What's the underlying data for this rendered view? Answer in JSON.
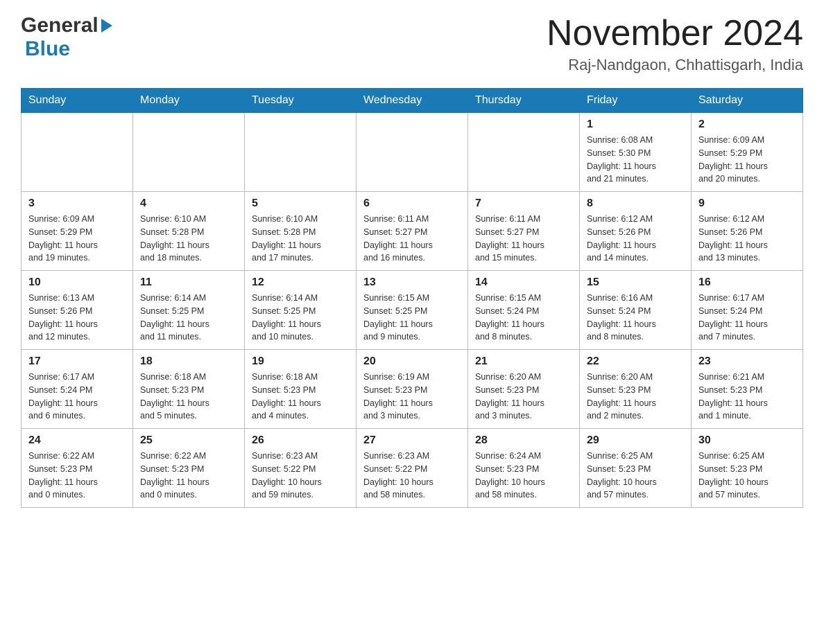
{
  "header": {
    "logo_general": "General",
    "logo_blue": "Blue",
    "title": "November 2024",
    "subtitle": "Raj-Nandgaon, Chhattisgarh, India"
  },
  "days_of_week": [
    "Sunday",
    "Monday",
    "Tuesday",
    "Wednesday",
    "Thursday",
    "Friday",
    "Saturday"
  ],
  "weeks": [
    [
      {
        "day": "",
        "info": ""
      },
      {
        "day": "",
        "info": ""
      },
      {
        "day": "",
        "info": ""
      },
      {
        "day": "",
        "info": ""
      },
      {
        "day": "",
        "info": ""
      },
      {
        "day": "1",
        "info": "Sunrise: 6:08 AM\nSunset: 5:30 PM\nDaylight: 11 hours\nand 21 minutes."
      },
      {
        "day": "2",
        "info": "Sunrise: 6:09 AM\nSunset: 5:29 PM\nDaylight: 11 hours\nand 20 minutes."
      }
    ],
    [
      {
        "day": "3",
        "info": "Sunrise: 6:09 AM\nSunset: 5:29 PM\nDaylight: 11 hours\nand 19 minutes."
      },
      {
        "day": "4",
        "info": "Sunrise: 6:10 AM\nSunset: 5:28 PM\nDaylight: 11 hours\nand 18 minutes."
      },
      {
        "day": "5",
        "info": "Sunrise: 6:10 AM\nSunset: 5:28 PM\nDaylight: 11 hours\nand 17 minutes."
      },
      {
        "day": "6",
        "info": "Sunrise: 6:11 AM\nSunset: 5:27 PM\nDaylight: 11 hours\nand 16 minutes."
      },
      {
        "day": "7",
        "info": "Sunrise: 6:11 AM\nSunset: 5:27 PM\nDaylight: 11 hours\nand 15 minutes."
      },
      {
        "day": "8",
        "info": "Sunrise: 6:12 AM\nSunset: 5:26 PM\nDaylight: 11 hours\nand 14 minutes."
      },
      {
        "day": "9",
        "info": "Sunrise: 6:12 AM\nSunset: 5:26 PM\nDaylight: 11 hours\nand 13 minutes."
      }
    ],
    [
      {
        "day": "10",
        "info": "Sunrise: 6:13 AM\nSunset: 5:26 PM\nDaylight: 11 hours\nand 12 minutes."
      },
      {
        "day": "11",
        "info": "Sunrise: 6:14 AM\nSunset: 5:25 PM\nDaylight: 11 hours\nand 11 minutes."
      },
      {
        "day": "12",
        "info": "Sunrise: 6:14 AM\nSunset: 5:25 PM\nDaylight: 11 hours\nand 10 minutes."
      },
      {
        "day": "13",
        "info": "Sunrise: 6:15 AM\nSunset: 5:25 PM\nDaylight: 11 hours\nand 9 minutes."
      },
      {
        "day": "14",
        "info": "Sunrise: 6:15 AM\nSunset: 5:24 PM\nDaylight: 11 hours\nand 8 minutes."
      },
      {
        "day": "15",
        "info": "Sunrise: 6:16 AM\nSunset: 5:24 PM\nDaylight: 11 hours\nand 8 minutes."
      },
      {
        "day": "16",
        "info": "Sunrise: 6:17 AM\nSunset: 5:24 PM\nDaylight: 11 hours\nand 7 minutes."
      }
    ],
    [
      {
        "day": "17",
        "info": "Sunrise: 6:17 AM\nSunset: 5:24 PM\nDaylight: 11 hours\nand 6 minutes."
      },
      {
        "day": "18",
        "info": "Sunrise: 6:18 AM\nSunset: 5:23 PM\nDaylight: 11 hours\nand 5 minutes."
      },
      {
        "day": "19",
        "info": "Sunrise: 6:18 AM\nSunset: 5:23 PM\nDaylight: 11 hours\nand 4 minutes."
      },
      {
        "day": "20",
        "info": "Sunrise: 6:19 AM\nSunset: 5:23 PM\nDaylight: 11 hours\nand 3 minutes."
      },
      {
        "day": "21",
        "info": "Sunrise: 6:20 AM\nSunset: 5:23 PM\nDaylight: 11 hours\nand 3 minutes."
      },
      {
        "day": "22",
        "info": "Sunrise: 6:20 AM\nSunset: 5:23 PM\nDaylight: 11 hours\nand 2 minutes."
      },
      {
        "day": "23",
        "info": "Sunrise: 6:21 AM\nSunset: 5:23 PM\nDaylight: 11 hours\nand 1 minute."
      }
    ],
    [
      {
        "day": "24",
        "info": "Sunrise: 6:22 AM\nSunset: 5:23 PM\nDaylight: 11 hours\nand 0 minutes."
      },
      {
        "day": "25",
        "info": "Sunrise: 6:22 AM\nSunset: 5:23 PM\nDaylight: 11 hours\nand 0 minutes."
      },
      {
        "day": "26",
        "info": "Sunrise: 6:23 AM\nSunset: 5:22 PM\nDaylight: 10 hours\nand 59 minutes."
      },
      {
        "day": "27",
        "info": "Sunrise: 6:23 AM\nSunset: 5:22 PM\nDaylight: 10 hours\nand 58 minutes."
      },
      {
        "day": "28",
        "info": "Sunrise: 6:24 AM\nSunset: 5:23 PM\nDaylight: 10 hours\nand 58 minutes."
      },
      {
        "day": "29",
        "info": "Sunrise: 6:25 AM\nSunset: 5:23 PM\nDaylight: 10 hours\nand 57 minutes."
      },
      {
        "day": "30",
        "info": "Sunrise: 6:25 AM\nSunset: 5:23 PM\nDaylight: 10 hours\nand 57 minutes."
      }
    ]
  ]
}
